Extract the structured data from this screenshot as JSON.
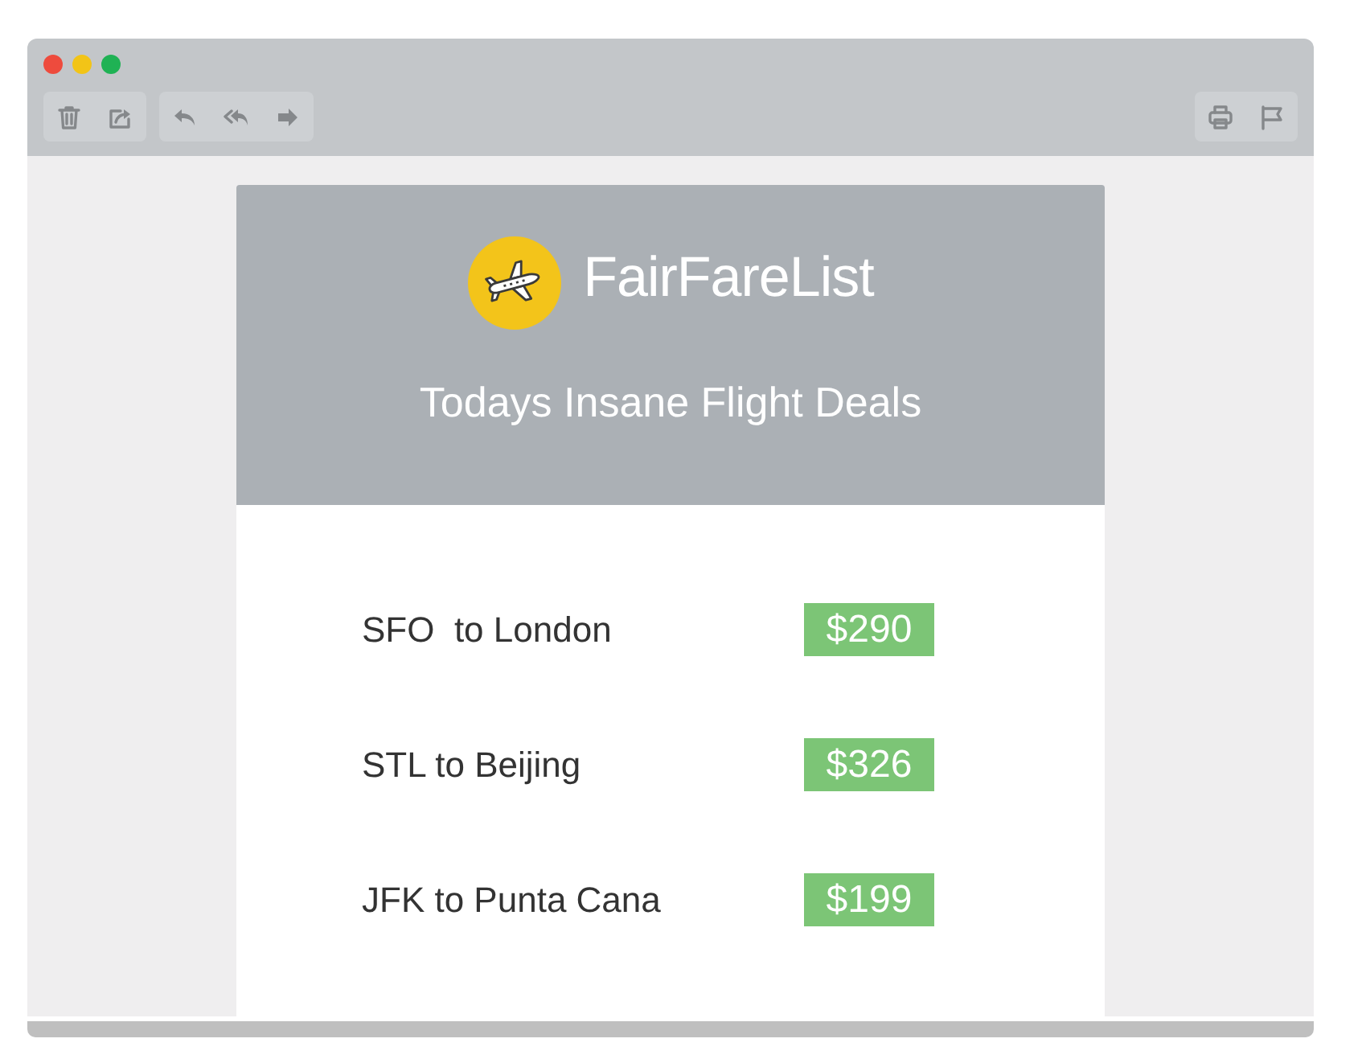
{
  "window": {
    "controls": [
      {
        "color": "#ee4b3d"
      },
      {
        "color": "#f2c417"
      },
      {
        "color": "#1fb254"
      }
    ]
  },
  "email": {
    "brand": "FairFareList",
    "headline": "Todays Insane Flight Deals",
    "deals": [
      {
        "route": "SFO  to London",
        "price": "$290"
      },
      {
        "route": "STL to Beijing",
        "price": "$326"
      },
      {
        "route": "JFK to Punta Cana",
        "price": "$199"
      }
    ]
  }
}
